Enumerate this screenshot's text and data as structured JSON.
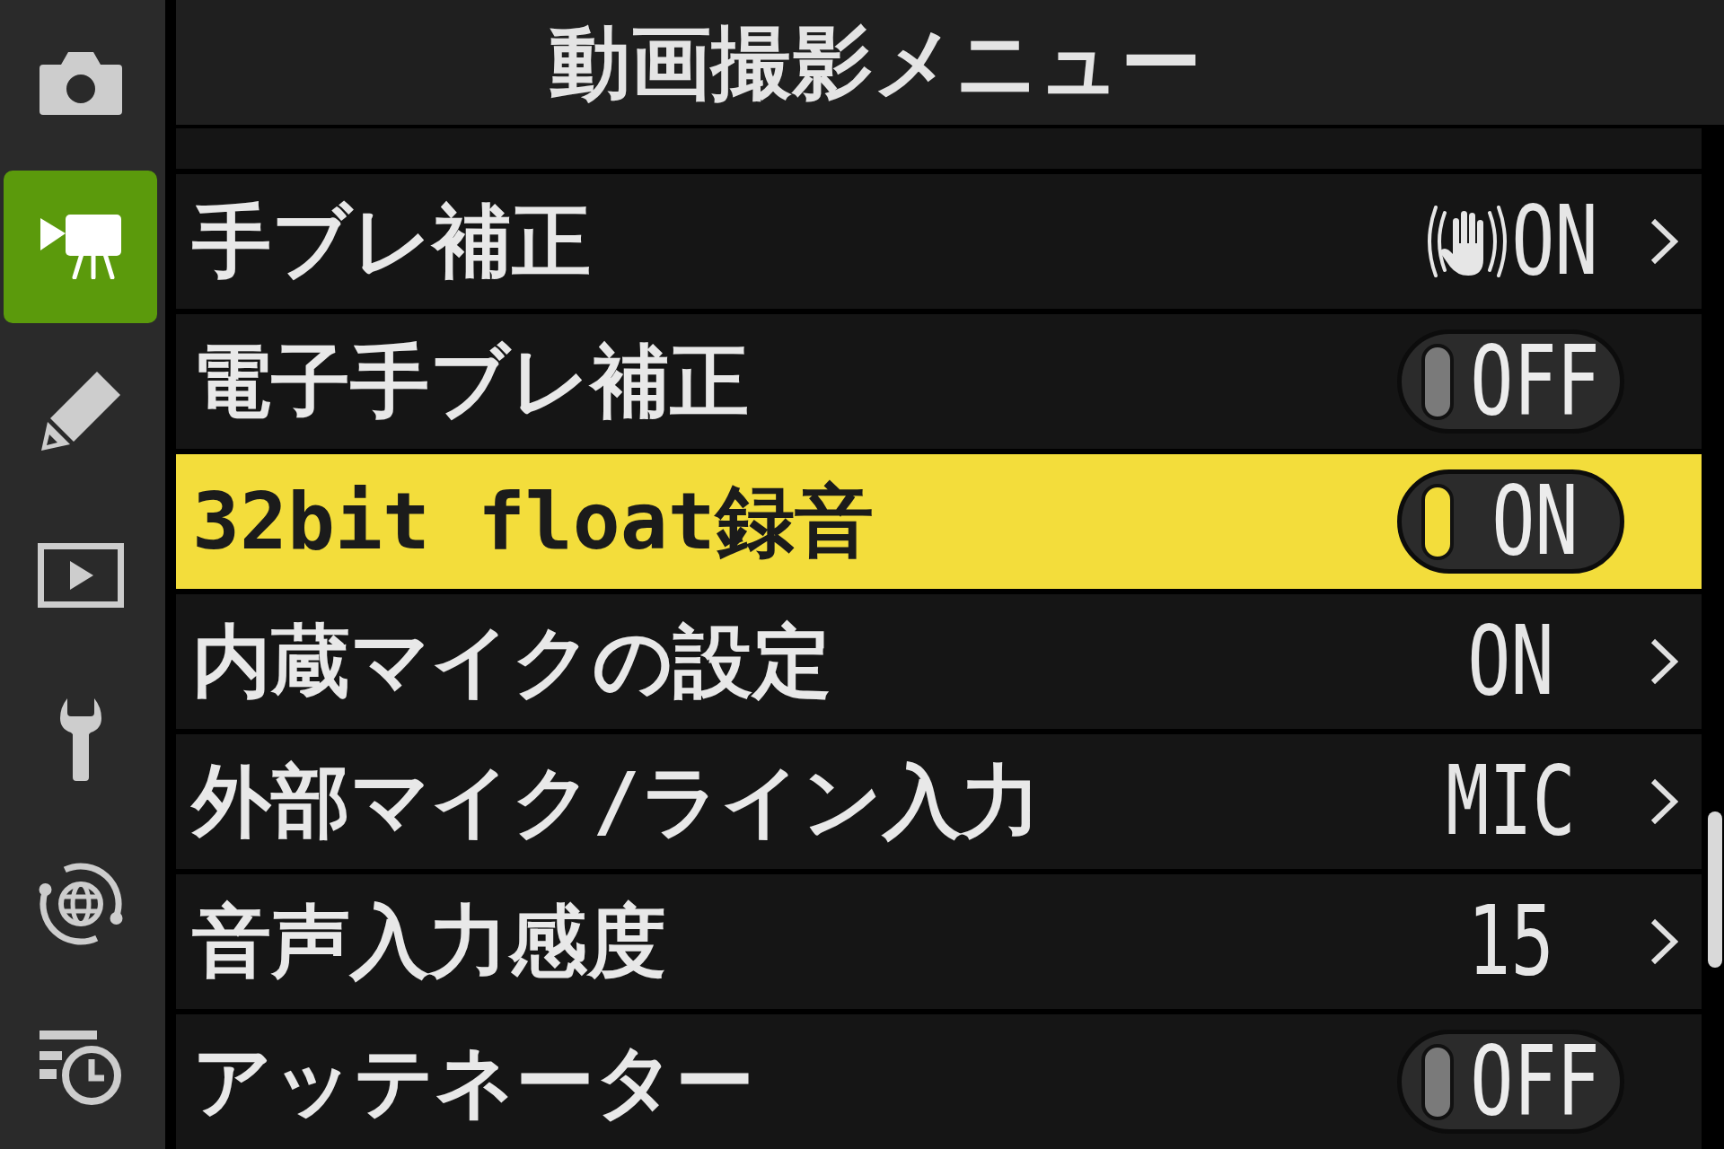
{
  "title": "動画撮影メニュー",
  "sidebar": {
    "items": [
      {
        "kind": "camera",
        "selected": false
      },
      {
        "kind": "movie",
        "selected": true
      },
      {
        "kind": "pencil",
        "selected": false
      },
      {
        "kind": "playback",
        "selected": false
      },
      {
        "kind": "wrench",
        "selected": false
      },
      {
        "kind": "network",
        "selected": false
      },
      {
        "kind": "recent",
        "selected": false
      }
    ]
  },
  "menu": {
    "rows": [
      {
        "label": "手ブレ補正",
        "kind": "submenu",
        "value": "ON",
        "value_icon": true,
        "selected": false
      },
      {
        "label": "電子手ブレ補正",
        "kind": "toggle",
        "value": "OFF",
        "on": false,
        "selected": false
      },
      {
        "label": "32bit float録音",
        "kind": "toggle",
        "value": "ON",
        "on": true,
        "selected": true
      },
      {
        "label": "内蔵マイクの設定",
        "kind": "submenu",
        "value": "ON",
        "selected": false
      },
      {
        "label": "外部マイク/ライン入力",
        "kind": "submenu",
        "value": "MIC",
        "selected": false
      },
      {
        "label": "音声入力感度",
        "kind": "submenu",
        "value": "15",
        "selected": false
      },
      {
        "label": "アッテネーター",
        "kind": "toggle",
        "value": "OFF",
        "on": false,
        "selected": false
      }
    ]
  }
}
